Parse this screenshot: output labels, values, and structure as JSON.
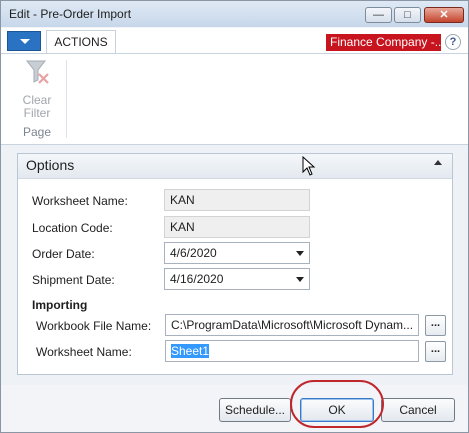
{
  "window": {
    "title": "Edit - Pre-Order Import",
    "controls": {
      "minimize_icon": "minimize-icon",
      "maximize_icon": "maximize-icon",
      "close_icon": "close-icon"
    }
  },
  "ribbon": {
    "tab": "ACTIONS",
    "company": "Finance Company -...",
    "help_glyph": "?",
    "group_label": "Page",
    "clear_filter_line1": "Clear",
    "clear_filter_line2": "Filter"
  },
  "options": {
    "title": "Options",
    "worksheet_name_label": "Worksheet Name:",
    "worksheet_name_value": "KAN",
    "location_code_label": "Location Code:",
    "location_code_value": "KAN",
    "order_date_label": "Order Date:",
    "order_date_value": "4/6/2020",
    "shipment_date_label": "Shipment Date:",
    "shipment_date_value": "4/16/2020"
  },
  "importing": {
    "heading": "Importing",
    "workbook_label": "Workbook File Name:",
    "workbook_value": "C:\\ProgramData\\Microsoft\\Microsoft Dynam...",
    "worksheet_label": "Worksheet Name:",
    "worksheet_value": "Sheet1",
    "assist_glyph": "..."
  },
  "buttons": {
    "schedule": "Schedule...",
    "ok": "OK",
    "cancel": "Cancel"
  },
  "colors": {
    "accent": "#2a73c2",
    "company_badge": "#c7141e",
    "highlight_ring": "#c0272d"
  }
}
